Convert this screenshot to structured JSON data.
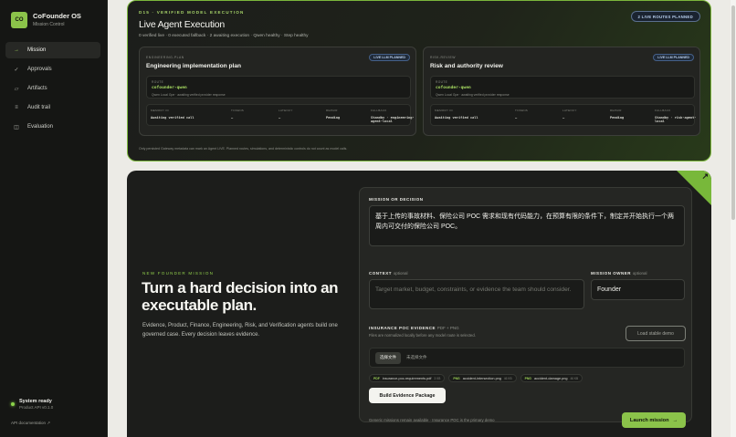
{
  "sidebar": {
    "logo": "CO",
    "title": "CoFounder OS",
    "subtitle": "Mission Control",
    "items": [
      {
        "label": "Mission",
        "icon": "→"
      },
      {
        "label": "Approvals",
        "icon": "✓"
      },
      {
        "label": "Artifacts",
        "icon": "▱"
      },
      {
        "label": "Audit trail",
        "icon": "≡"
      },
      {
        "label": "Evaluation",
        "icon": "◫"
      }
    ],
    "status_title": "System ready",
    "status_sub": "Product API v0.1.0",
    "api_doc": "API documentation ↗"
  },
  "exec": {
    "kicker": "D15 · VERIFIED MODEL EXECUTION",
    "title": "Live Agent Execution",
    "meta": "0 verified live · 0 executed fallback · 2 awaiting execution · Qwen healthy · Step healthy",
    "routes_badge": "2 LIVE ROUTES PLANNED",
    "footer": "Only persisted Gateway metadata can mark an Agent LIVE. Planned routes, simulations, and deterministic controls do not count as model calls.",
    "cards": [
      {
        "kicker": "ENGINEERING-PLAN",
        "title": "Engineering implementation plan",
        "badge": "LIVE LLM PLANNED",
        "route_label": "ROUTE",
        "model": "cofounder-qwen",
        "route_sub": "Qwen Local Gpe · awaiting verified provider response",
        "headers": [
          "MEMORY ID",
          "TOKENS",
          "LATENCY",
          "REPAIR",
          "FALLBACK"
        ],
        "values": [
          "Awaiting verified call",
          "—",
          "—",
          "Pending",
          "Standby · engineering-agent-local"
        ]
      },
      {
        "kicker": "RISK-REVIEW",
        "title": "Risk and authority review",
        "badge": "LIVE LLM PLANNED",
        "route_label": "ROUTE",
        "model": "cofounder-qwen",
        "route_sub": "Qwen Local Gpe · awaiting verified provider response",
        "headers": [
          "MEMORY ID",
          "TOKENS",
          "LATENCY",
          "REPAIR",
          "FALLBACK"
        ],
        "values": [
          "Awaiting verified call",
          "—",
          "—",
          "Pending",
          "Standby · risk-agent-local"
        ]
      }
    ]
  },
  "mission": {
    "kicker": "NEW FOUNDER MISSION",
    "title": "Turn a hard decision into an executable plan.",
    "description": "Evidence, Product, Finance, Engineering, Risk, and Verification agents build one governed case. Every decision leaves evidence.",
    "form": {
      "decision_label": "MISSION OR DECISION",
      "decision_value": "基于上传的事故材料、保险公司 POC 需求和现有代码能力，在预算有限的条件下，制定并开始执行一个两周内可交付的保险公司 POC。",
      "context_label": "CONTEXT",
      "context_optional": "optional",
      "context_placeholder": "Target market, budget, constraints, or evidence the team should consider.",
      "owner_label": "MISSION OWNER",
      "owner_optional": "optional",
      "owner_value": "Founder",
      "evidence_label": "INSURANCE POC EVIDENCE",
      "evidence_types": "PDF + PNG",
      "evidence_hint": "Files are normalized locally before any model route is selected.",
      "demo_button": "Load stable demo",
      "file_button": "选择文件",
      "file_none": "未选择文件",
      "files": [
        {
          "type": "PDF",
          "name": "insurance-poc-requirements.pdf",
          "size": "3 KB"
        },
        {
          "type": "PNG",
          "name": "accident-intersection.png",
          "size": "46 KB"
        },
        {
          "type": "PNG",
          "name": "accident-damage.png",
          "size": "46 KB"
        }
      ],
      "build_button": "Build Evidence Package",
      "footer": "Generic missions remain available · Insurance POC is the primary demo",
      "launch_button": "Launch mission",
      "launch_arrow": "→"
    }
  }
}
